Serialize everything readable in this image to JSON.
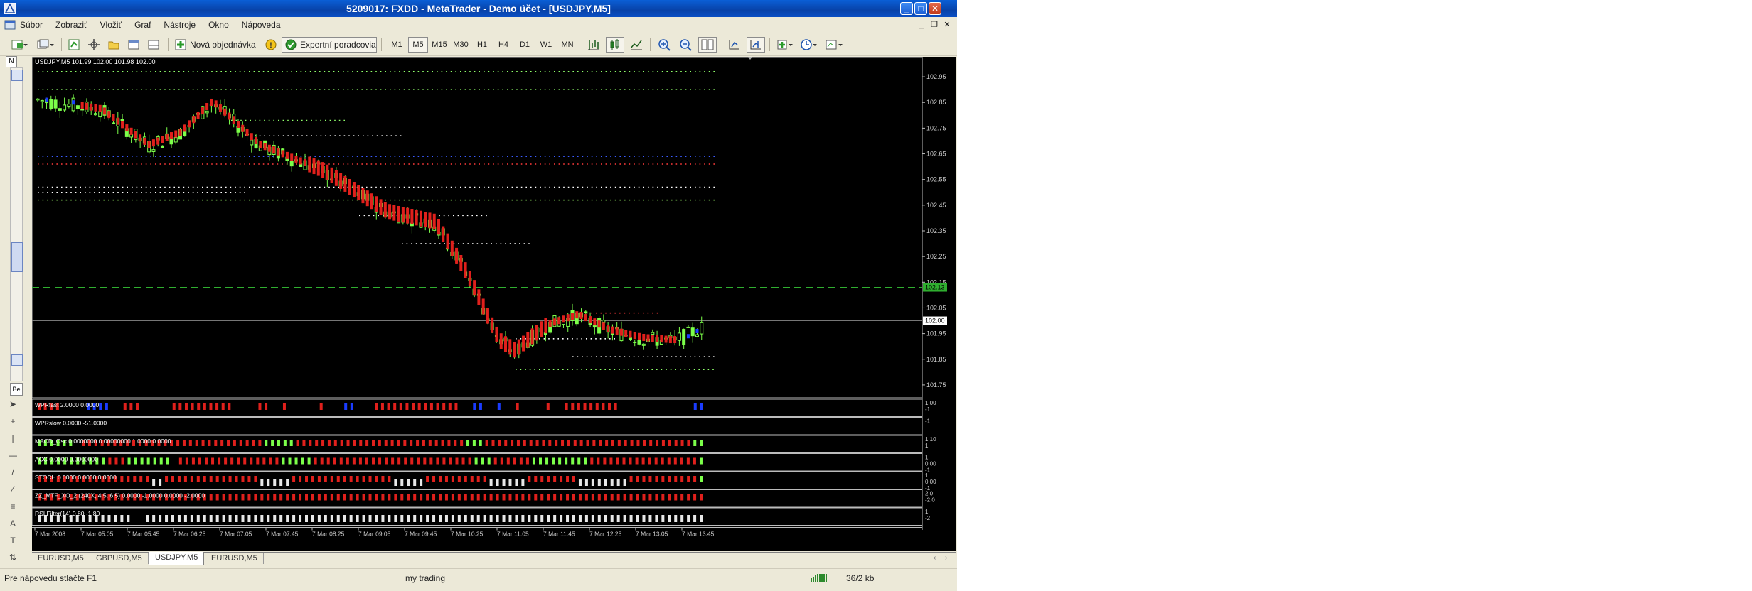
{
  "window": {
    "title": "5209017: FXDD - MetaTrader - Demo účet - [USDJPY,M5]"
  },
  "menu": [
    "Súbor",
    "Zobraziť",
    "Vložiť",
    "Graf",
    "Nástroje",
    "Okno",
    "Nápoveda"
  ],
  "toolbar": {
    "new_order": "Nová objednávka",
    "expert_advisors": "Expertní poradcovia",
    "timeframes": [
      "M1",
      "M5",
      "M15",
      "M30",
      "H1",
      "H4",
      "D1",
      "W1",
      "MN"
    ],
    "active_timeframe": "M5"
  },
  "navigator_stub": "N",
  "chart": {
    "header": "USDJPY,M5  101.99 102.00 101.98 102.00",
    "price_labels": [
      "102.95",
      "102.85",
      "102.75",
      "102.65",
      "102.55",
      "102.45",
      "102.35",
      "102.25",
      "102.15",
      "102.05",
      "101.95",
      "101.85",
      "101.75"
    ],
    "current_price_tag": "102.00",
    "line_price_tag": "102.13",
    "indicators": [
      {
        "label": "WPRfast 2.0000 0.0000",
        "scale": [
          "1.00",
          "-1"
        ]
      },
      {
        "label": "WPRslow 0.0000 -51.0000",
        "scale": [
          "-1"
        ]
      },
      {
        "label": "MACD_Osc 0.0000000 0.00000000 1.0000 0.0000",
        "scale": [
          "1.10",
          "1"
        ]
      },
      {
        "label": "ACC 0.0000 0.0000000",
        "scale": [
          "1",
          "0.00",
          "-1"
        ]
      },
      {
        "label": "STOCH 0.0000 0.0000 0.0000",
        "scale": [
          "1",
          "0.00",
          "-1"
        ]
      },
      {
        "label": "ZZ_MTF_XO_2 (240X, 4.5, 6.5)  0.0000 -1.0000 0.0000 -2.0000",
        "scale": [
          "2.0",
          "-2.0"
        ]
      },
      {
        "label": "RSI Filter(14) 0.80 -1.80",
        "scale": [
          "1",
          "-2"
        ]
      }
    ],
    "time_labels": [
      "7 Mar 2008",
      "7 Mar 05:05",
      "7 Mar 05:45",
      "7 Mar 06:25",
      "7 Mar 07:05",
      "7 Mar 07:45",
      "7 Mar 08:25",
      "7 Mar 09:05",
      "7 Mar 09:45",
      "7 Mar 10:25",
      "7 Mar 11:05",
      "7 Mar 11:45",
      "7 Mar 12:25",
      "7 Mar 13:05",
      "7 Mar 13:45"
    ],
    "colors": {
      "bull": "#7cff4a",
      "bear": "#e0201c",
      "blue": "#1a3cff",
      "grid": "#ffffff"
    }
  },
  "tabs": [
    "EURUSD,M5",
    "GBPUSD,M5",
    "USDJPY,M5",
    "EURUSD,M5"
  ],
  "active_tab": "USDJPY,M5",
  "status": {
    "help": "Pre nápovedu stlačte F1",
    "profile": "my trading",
    "traffic": "36/2 kb"
  }
}
